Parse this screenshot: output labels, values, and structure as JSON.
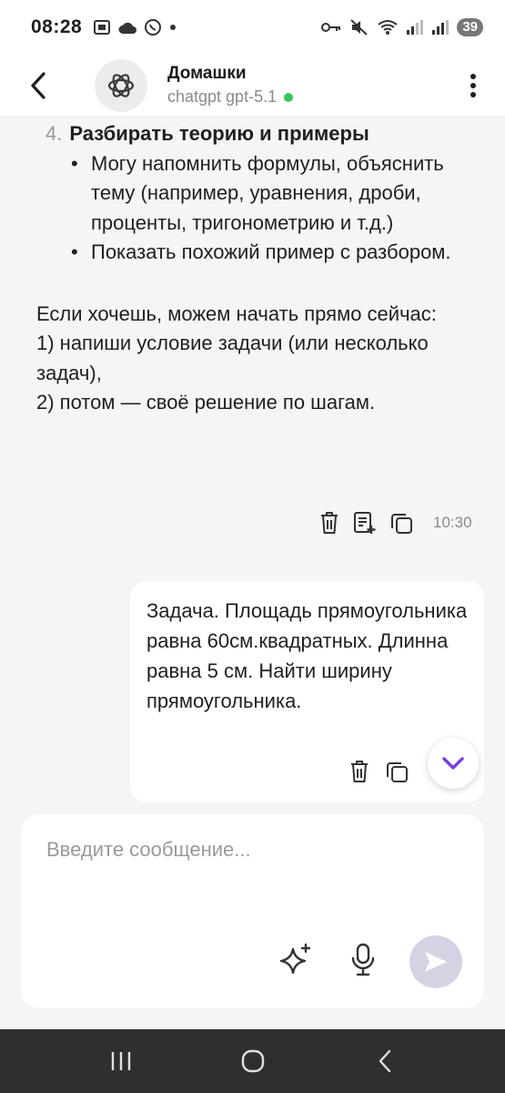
{
  "status_bar": {
    "time": "08:28",
    "battery": "39"
  },
  "header": {
    "title": "Домашки",
    "subtitle": "chatgpt gpt-5.1"
  },
  "assistant_message": {
    "list_number": "4.",
    "list_title": "Разбирать теорию и примеры",
    "bullets": [
      "Могу напомнить формулы, объяснить тему (например, уравнения, дроби, проценты, тригонометрию и т.д.)",
      "Показать похожий пример с разбором."
    ],
    "paragraph_lines": [
      "Если хочешь, можем начать прямо сейчас:",
      "1) напиши условие задачи (или несколько задач),",
      "2) потом — своё решение по шагам."
    ],
    "time": "10:30"
  },
  "user_message": {
    "text": "Задача. Площадь прямоугольника равна 60см.квадратных. Длинна равна 5 см. Найти ширину прямоугольника."
  },
  "composer": {
    "placeholder": "Введите сообщение..."
  },
  "colors": {
    "accent": "#7b3fe4",
    "online": "#34c759",
    "send_disabled": "#d7d2e3"
  }
}
